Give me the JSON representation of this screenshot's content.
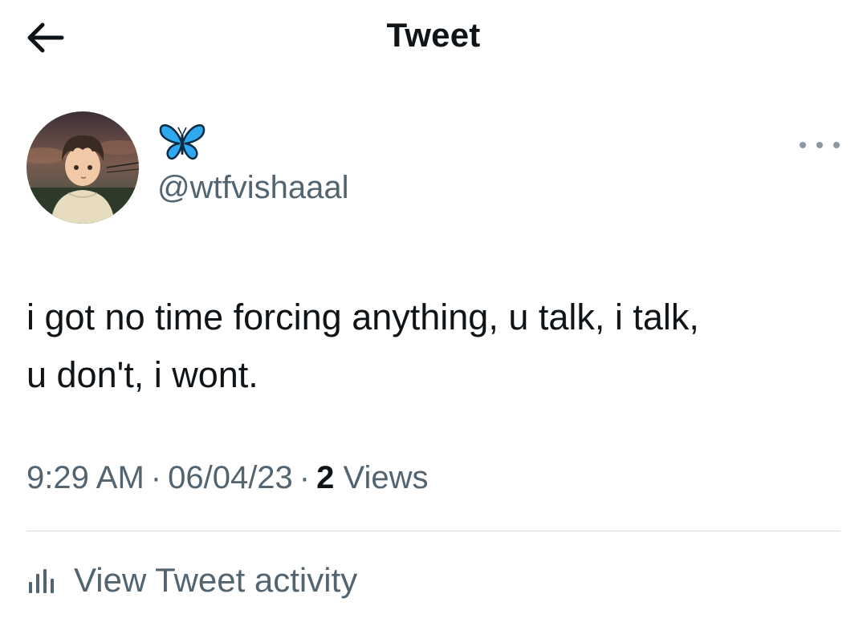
{
  "header": {
    "title": "Tweet",
    "back_icon": "arrow-left-icon"
  },
  "author": {
    "display_icon": "butterfly-emoji",
    "handle": "@wtfvishaaal",
    "avatar": "avatar-illustration"
  },
  "more_icon": "more-dots-icon",
  "tweet": {
    "line1": "i got no time forcing anything, u talk, i talk,",
    "line2": "u don't, i wont."
  },
  "meta": {
    "time": "9:29 AM",
    "separator": "·",
    "date": "06/04/23",
    "views_count": "2",
    "views_label": "Views"
  },
  "activity": {
    "icon": "bar-chart-icon",
    "label": "View Tweet activity"
  },
  "colors": {
    "text": "#0f1419",
    "secondary": "#536471",
    "divider": "#d5dbe0",
    "butterfly": "#2ea9f0"
  }
}
